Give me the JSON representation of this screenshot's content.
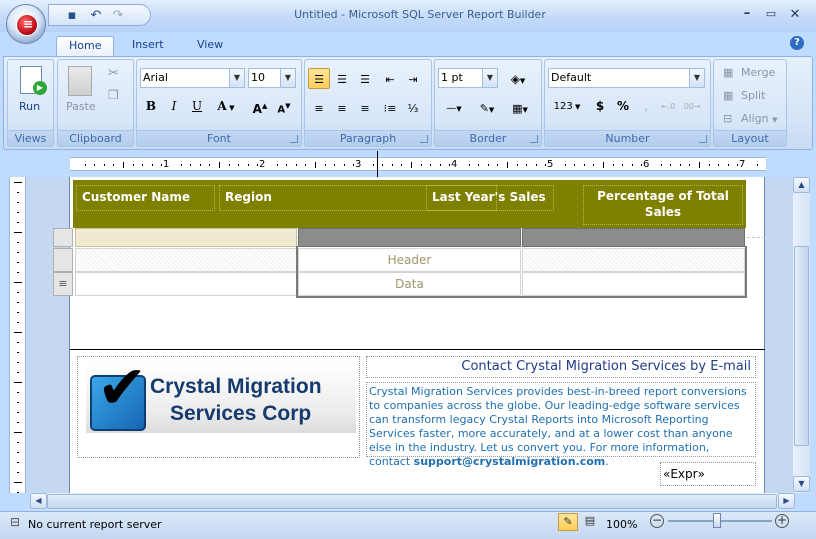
{
  "window": {
    "title": "Untitled - Microsoft SQL Server Report Builder"
  },
  "qat": {
    "save": "save-icon",
    "undo": "undo-icon",
    "redo": "redo-icon"
  },
  "tabs": [
    {
      "label": "Home",
      "active": true
    },
    {
      "label": "Insert"
    },
    {
      "label": "View"
    }
  ],
  "ribbon": {
    "views": {
      "label": "Views",
      "run": "Run"
    },
    "clipboard": {
      "label": "Clipboard",
      "paste": "Paste"
    },
    "font": {
      "label": "Font",
      "family": "Arial",
      "size": "10"
    },
    "paragraph": {
      "label": "Paragraph"
    },
    "border": {
      "label": "Border",
      "width": "1 pt"
    },
    "number": {
      "label": "Number",
      "format": "Default",
      "placeholder": "123",
      "currency": "$",
      "percent": "%"
    },
    "layout": {
      "label": "Layout",
      "merge": "Merge",
      "split": "Split",
      "align": "Align"
    }
  },
  "ruler": {
    "numbers": [
      "1",
      "2",
      "3",
      "4",
      "5",
      "6",
      "7"
    ]
  },
  "report": {
    "page_header": {
      "columns": [
        "Customer Name",
        "Region",
        "Last Year's Sales",
        "Percentage of Total Sales"
      ],
      "band_color": "#7F7F00"
    },
    "tablix": {
      "header_cell": "Header",
      "data_cell": "Data",
      "row_handle": "≡"
    },
    "footer": {
      "logo_line1": "Crystal Migration",
      "logo_line2": "Services Corp",
      "contact": "Contact Crystal Migration Services by E-mail",
      "blurb": "Crystal Migration Services provides best-in-breed report conversions to companies across the globe. Our leading-edge software services can transform legacy Crystal Reports into Microsoft Reporting Services faster, more accurately, and at a lower cost than anyone else in the industry. Let us convert you. For more information, contact",
      "email": "support@crystalmigration.com",
      "expr": "«Expr»"
    }
  },
  "status": {
    "text": "No current report server",
    "zoom": "100%"
  }
}
